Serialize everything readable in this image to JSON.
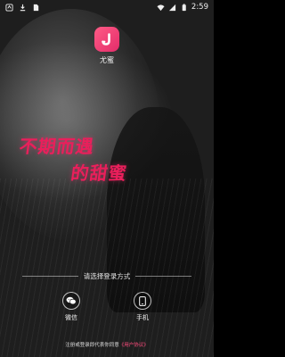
{
  "status_bar": {
    "time": "2:59",
    "icons": [
      "app-notification-icon",
      "download-icon",
      "file-icon",
      "wifi-icon",
      "signal-icon",
      "battery-icon"
    ]
  },
  "app": {
    "logo_letter": "J",
    "name": "尤蜜",
    "brand_color": "#e32c6a"
  },
  "slogan": {
    "line1": "不期而遇",
    "line2": "的甜蜜"
  },
  "login": {
    "title": "请选择登录方式",
    "options": [
      {
        "label": "微信",
        "icon": "wechat-icon"
      },
      {
        "label": "手机",
        "icon": "phone-icon"
      }
    ],
    "agreement_prefix": "注册或登录即代表你同意",
    "agreement_link": "《用户协议》"
  }
}
